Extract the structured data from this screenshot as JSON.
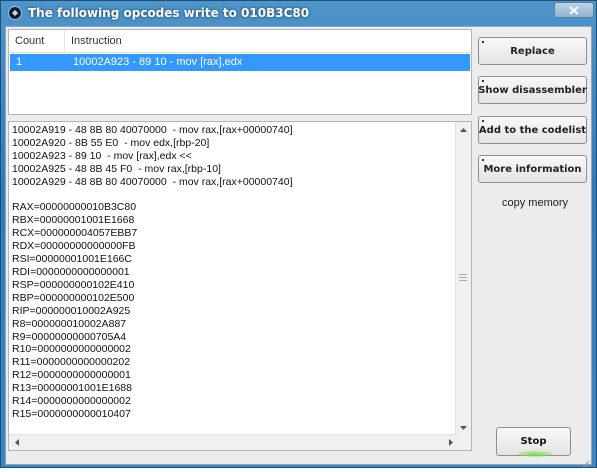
{
  "window": {
    "title": "The following opcodes write to 010B3C80"
  },
  "list": {
    "columns": [
      "Count",
      "Instruction"
    ],
    "rows": [
      {
        "count": "1",
        "instruction": "10002A923 - 89 10  - mov [rax],edx"
      }
    ]
  },
  "details": {
    "text": "10002A919 - 48 8B 80 40070000  - mov rax,[rax+00000740]\n10002A920 - 8B 55 E0  - mov edx,[rbp-20]\n10002A923 - 89 10  - mov [rax],edx <<\n10002A925 - 48 8B 45 F0  - mov rax,[rbp-10]\n10002A929 - 48 8B 80 40070000  - mov rax,[rax+00000740]\n\nRAX=00000000010B3C80\nRBX=00000001001E1668\nRCX=000000004057EBB7\nRDX=00000000000000FB\nRSI=00000001001E166C\nRDI=0000000000000001\nRSP=000000000102E410\nRBP=000000000102E500\nRIP=000000010002A925\nR8=000000010002A887\nR9=00000000000705A4\nR10=0000000000000002\nR11=0000000000000202\nR12=0000000000000001\nR13=00000001001E1688\nR14=0000000000000002\nR15=0000000000010407"
  },
  "buttons": {
    "replace": "Replace",
    "show_disassembler": "Show disassembler",
    "add_to_codelist": "Add to the codelist",
    "more_information": "More information",
    "copy_memory": "copy memory",
    "stop": "Stop"
  },
  "icons": {
    "app": "cheat-engine-icon",
    "close": "close-icon"
  }
}
